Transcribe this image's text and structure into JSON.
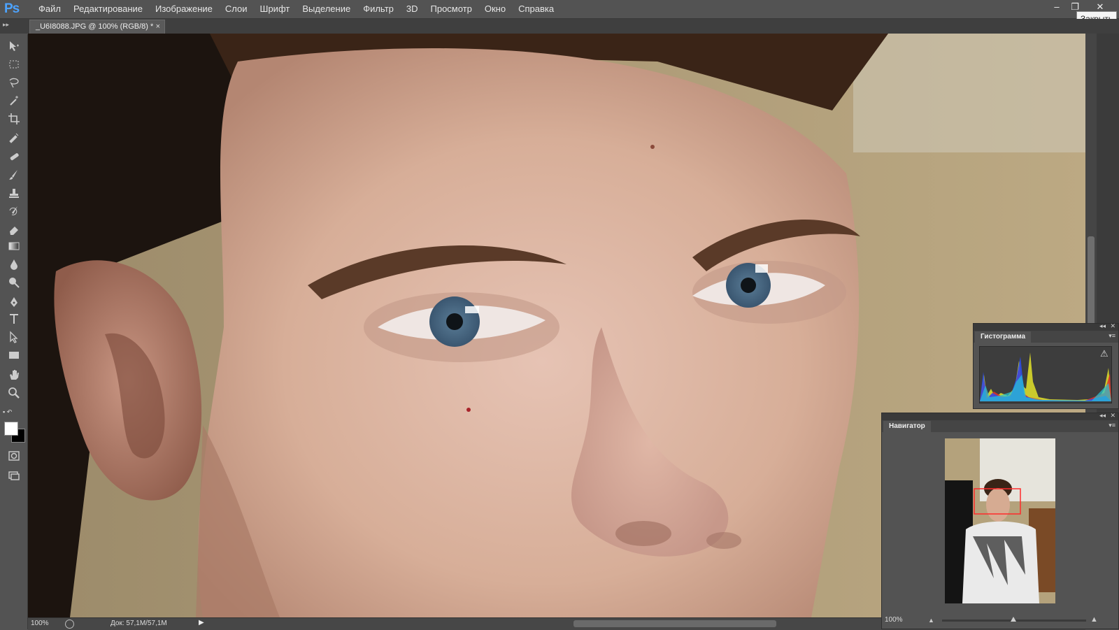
{
  "app": {
    "logo": "Ps"
  },
  "menu": [
    "Файл",
    "Редактирование",
    "Изображение",
    "Слои",
    "Шрифт",
    "Выделение",
    "Фильтр",
    "3D",
    "Просмотр",
    "Окно",
    "Справка"
  ],
  "window": {
    "minimize": "–",
    "restore": "❐",
    "close": "✕",
    "close_tooltip": "Закрыть"
  },
  "document_tab": {
    "title": "_U6I8088.JPG @ 100% (RGB/8) *",
    "close": "×"
  },
  "tools": [
    "move",
    "marquee",
    "lasso",
    "magic-wand",
    "crop",
    "eyedropper",
    "healing-brush",
    "brush",
    "clone-stamp",
    "history-brush",
    "eraser",
    "gradient",
    "blur",
    "dodge",
    "pen",
    "type",
    "path-selection",
    "rectangle",
    "hand",
    "zoom"
  ],
  "colors": {
    "foreground": "#ffffff",
    "background": "#000000",
    "accent": "#4da3ff"
  },
  "status": {
    "zoom": "100%",
    "doc": "Док: 57,1M/57,1M",
    "arrow": "▶"
  },
  "histogram_panel": {
    "title": "Гистограмма",
    "warning": "⚠"
  },
  "navigator_panel": {
    "title": "Навигатор",
    "zoom": "100%",
    "zoom_level": 1.0
  }
}
